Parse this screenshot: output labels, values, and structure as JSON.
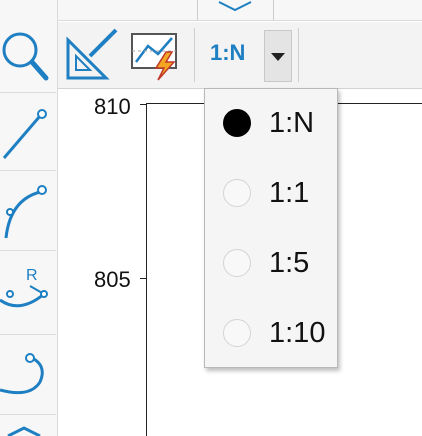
{
  "toolbar": {
    "scale_label": "1:N"
  },
  "graph": {
    "y_tick_labels": [
      "810",
      "805"
    ]
  },
  "scale_menu": {
    "options": [
      {
        "label": "1:N",
        "selected": true
      },
      {
        "label": "1:1",
        "selected": false
      },
      {
        "label": "1:5",
        "selected": false
      },
      {
        "label": "1:10",
        "selected": false
      }
    ]
  },
  "colors": {
    "accent": "#1e7fc2",
    "lightning": "#f5a623"
  }
}
